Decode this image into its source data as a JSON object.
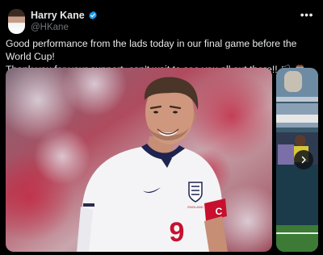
{
  "author": {
    "name": "Harry Kane",
    "handle": "@HKane",
    "verified_icon": "verified-badge-icon",
    "more_icon": "more-horizontal-icon",
    "more_glyph": "•••"
  },
  "tweet": {
    "line1": "Good performance from the lads today in our final game before the World Cup!",
    "line2": "Thank you for your support, can’t wait to see you all out there!!",
    "emojis": "🏳 🦁 🦁 🦁"
  },
  "media": {
    "main_photo": {
      "shirt_number": "9",
      "badge_text": "ENGLAND",
      "armband_letter": "C"
    },
    "next_icon": "chevron-right-icon"
  },
  "colors": {
    "background": "#000000",
    "text": "#e7e9ea",
    "muted": "#71767b",
    "verified": "#1d9bf0",
    "shirt_number": "#c8102e"
  }
}
